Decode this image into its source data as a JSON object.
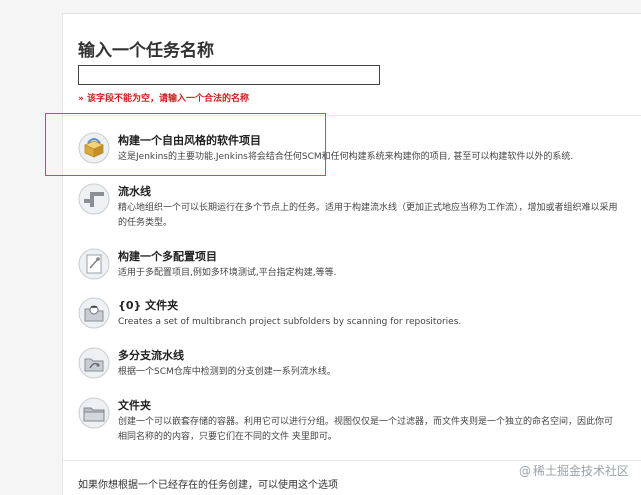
{
  "page": {
    "title": "输入一个任务名称",
    "name_input": {
      "value": "",
      "placeholder": ""
    },
    "error": "» 该字段不能为空，请输入一个合法的名称"
  },
  "items": [
    {
      "label": "构建一个自由风格的软件项目",
      "desc1": "这是Jenkins的主要功能.Jenkins将会结合任何SCM和任何构建系统来构建你的项目, 甚至可以构建软件以外的系统.",
      "desc2": "",
      "icon": "freestyle-box-icon"
    },
    {
      "label": "流水线",
      "desc1": "精心地组织一个可以长期运行在多个节点上的任务。适用于构建流水线（更加正式地应当称为工作流），增加或者组织难以采用",
      "desc2": "的任务类型。",
      "icon": "pipeline-icon"
    },
    {
      "label": "构建一个多配置项目",
      "desc1": "适用于多配置项目,例如多环境测试,平台指定构建,等等.",
      "desc2": "",
      "icon": "multi-config-icon"
    },
    {
      "label": "{0} 文件夹",
      "desc1": "Creates a set of multibranch project subfolders by scanning for repositories.",
      "desc2": "",
      "icon": "org-folder-icon"
    },
    {
      "label": "多分支流水线",
      "desc1": "根据一个SCM仓库中检测到的分支创建一系列流水线。",
      "desc2": "",
      "icon": "multibranch-icon"
    },
    {
      "label": "文件夹",
      "desc1": "创建一个可以嵌套存储的容器。利用它可以进行分组。视图仅仅是一个过滤器，而文件夹则是一个独立的命名空间，因此你可",
      "desc2": "相同名称的的内容，只要它们在不同的文件 夹里即可。",
      "icon": "folder-icon"
    }
  ],
  "footer": {
    "copy_text": "如果你想根据一个已经存在的任务创建，可以使用这个选项"
  },
  "watermark": {
    "text": "稀土掘金技术社区"
  }
}
